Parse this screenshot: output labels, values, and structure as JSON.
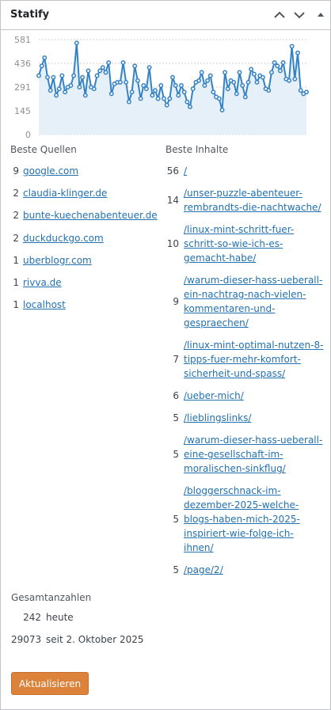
{
  "widget": {
    "title": "Statify"
  },
  "header_icons": [
    "chevron-up-icon",
    "chevron-down-icon",
    "triangle-up-icon"
  ],
  "chart_data": {
    "type": "area",
    "yticks": [
      "581",
      "436",
      "291",
      "145",
      "0"
    ],
    "ylim": [
      0,
      581
    ],
    "grid": true,
    "color": "#3582c4",
    "fill": "#e5f0f9",
    "values": [
      360,
      420,
      470,
      350,
      270,
      350,
      240,
      280,
      360,
      260,
      290,
      300,
      360,
      560,
      290,
      350,
      240,
      390,
      290,
      280,
      360,
      390,
      410,
      380,
      440,
      250,
      310,
      320,
      320,
      440,
      320,
      200,
      260,
      420,
      330,
      220,
      300,
      280,
      410,
      240,
      270,
      220,
      300,
      220,
      180,
      220,
      350,
      300,
      240,
      300,
      260,
      200,
      170,
      280,
      320,
      330,
      380,
      300,
      330,
      360,
      260,
      230,
      220,
      150,
      380,
      280,
      330,
      320,
      250,
      380,
      300,
      230,
      320,
      400,
      370,
      320,
      360,
      350,
      280,
      270,
      380,
      440,
      420,
      390,
      440,
      340,
      330,
      540,
      340,
      500,
      270,
      250,
      260
    ]
  },
  "sources": {
    "title": "Beste Quellen",
    "items": [
      {
        "count": "9",
        "label": "google.com"
      },
      {
        "count": "2",
        "label": "claudia-klinger.de"
      },
      {
        "count": "2",
        "label": "bunte-kuechenabenteuer.de"
      },
      {
        "count": "2",
        "label": "duckduckgo.com"
      },
      {
        "count": "1",
        "label": "uberblogr.com"
      },
      {
        "count": "1",
        "label": "rivva.de"
      },
      {
        "count": "1",
        "label": "localhost"
      }
    ]
  },
  "content": {
    "title": "Beste Inhalte",
    "items": [
      {
        "count": "56",
        "lines": [
          "/"
        ]
      },
      {
        "count": "14",
        "lines": [
          "/unser-puzzle-abenteuer-",
          "rembrandts-die-nachtwache/"
        ]
      },
      {
        "count": "10",
        "lines": [
          "/linux-mint-schritt-fuer-",
          "schritt-so-wie-ich-es-",
          "gemacht-habe/"
        ]
      },
      {
        "count": "9",
        "lines": [
          "/warum-dieser-hass-ueberall-",
          "ein-nachtrag-nach-vielen-",
          "kommentaren-und-",
          "gespraechen/"
        ]
      },
      {
        "count": "7",
        "lines": [
          "/linux-mint-optimal-nutzen-8-",
          "tipps-fuer-mehr-komfort-",
          "sicherheit-und-spass/"
        ]
      },
      {
        "count": "6",
        "lines": [
          "/ueber-mich/"
        ]
      },
      {
        "count": "5",
        "lines": [
          "/lieblingslinks/"
        ]
      },
      {
        "count": "5",
        "lines": [
          "/warum-dieser-hass-ueberall-",
          "eine-gesellschaft-im-",
          "moralischen-sinkflug/"
        ]
      },
      {
        "count": "5",
        "lines": [
          "/bloggerschnack-im-",
          "dezember-2025-welche-",
          "blogs-haben-mich-2025-",
          "inspiriert-wie-folge-ich-",
          "ihnen/"
        ]
      },
      {
        "count": "5",
        "lines": [
          "/page/2/"
        ]
      }
    ]
  },
  "totals": {
    "title": "Gesamtanzahlen",
    "rows": [
      {
        "num": "242",
        "label": "heute"
      },
      {
        "num": "29073",
        "label": "seit 2. Oktober 2025"
      }
    ]
  },
  "button": {
    "label": "Aktualisieren"
  }
}
